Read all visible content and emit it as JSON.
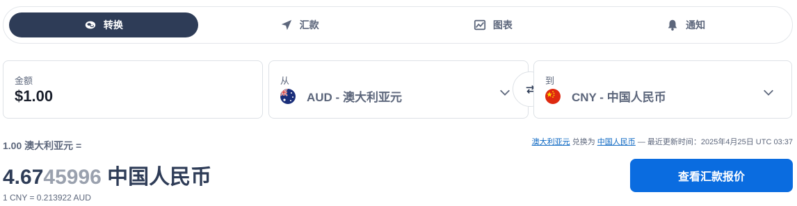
{
  "tabs": [
    {
      "label": "转换",
      "icon": "exchange-coins-icon",
      "active": true
    },
    {
      "label": "汇款",
      "icon": "send-icon",
      "active": false
    },
    {
      "label": "图表",
      "icon": "chart-icon",
      "active": false
    },
    {
      "label": "通知",
      "icon": "bell-icon",
      "active": false
    }
  ],
  "amount": {
    "label": "金额",
    "value": "$1.00"
  },
  "from": {
    "label": "从",
    "currency": "AUD - 澳大利亚元",
    "flag": "australia-flag-icon"
  },
  "to": {
    "label": "到",
    "currency": "CNY - 中国人民币",
    "flag": "china-flag-icon"
  },
  "result": {
    "from_text": "1.00 澳大利亚元 =",
    "value_main": "4.67",
    "value_faded": "45996",
    "currency": "中国人民币",
    "inverse": "1 CNY = 0.213922 AUD"
  },
  "update": {
    "from_link": "澳大利亚元",
    "convert_word": "兑换为",
    "to_link": "中国人民币",
    "suffix": "— 最近更新时间：2025年4月25日 UTC 03:37"
  },
  "cta": {
    "label": "查看汇款报价"
  },
  "colors": {
    "primary": "#2e3c57",
    "accent": "#0a6ce0",
    "link": "#0a66c2"
  }
}
